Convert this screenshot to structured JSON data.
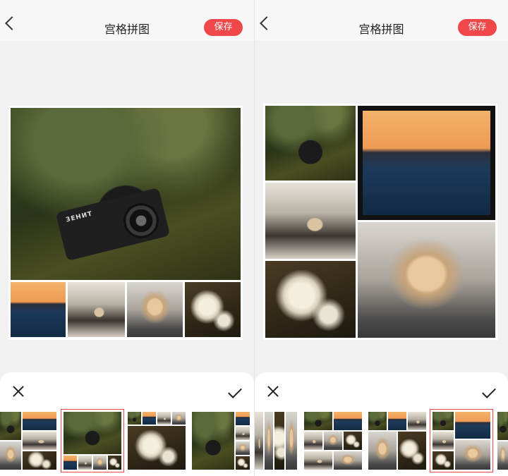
{
  "left_screen": {
    "header": {
      "title": "宫格拼图",
      "save_label": "保存",
      "back_icon": "chevron-left-icon"
    },
    "collage": {
      "layout": "1 large + 4 small",
      "camera_text": "ЗЕНИТ"
    },
    "bottom_panel": {
      "close_icon": "close-icon",
      "confirm_icon": "check-icon",
      "selected_template_index": 1
    }
  },
  "right_screen": {
    "header": {
      "title": "宫格拼图",
      "save_label": "保存",
      "back_icon": "chevron-left-icon"
    },
    "collage": {
      "layout": "3 left column + 2 right column"
    },
    "bottom_panel": {
      "close_icon": "close-icon",
      "confirm_icon": "check-icon",
      "selected_template_index": 3
    }
  },
  "colors": {
    "accent": "#f0474b",
    "background": "#f0f0f0",
    "panel": "#ffffff"
  }
}
